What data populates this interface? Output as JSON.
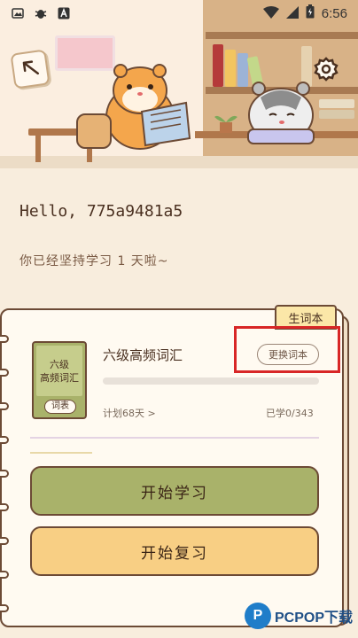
{
  "status_bar": {
    "time": "6:56",
    "left_icons": [
      "photo-icon",
      "bug-icon",
      "a-icon"
    ],
    "right_icons": [
      "wifi-icon",
      "signal-icon",
      "battery-icon"
    ]
  },
  "header": {
    "back_icon": "back-arrow-icon",
    "settings_icon": "gear-icon"
  },
  "greeting": {
    "hello": "Hello, 775a9481a5",
    "persist": "你已经坚持学习 1 天啦~"
  },
  "wordbook": {
    "tab_label": "生词本",
    "cover_title": "六级\n高频词汇",
    "cover_badge": "词表",
    "title": "六级高频词汇",
    "change_label": "更换词本",
    "plan": "计划68天 >",
    "learned": "已学0/343",
    "progress_fraction": 0
  },
  "actions": {
    "start_learn": "开始学习",
    "start_review": "开始复习"
  },
  "watermark": {
    "logo_letter": "P",
    "text": "PCPOP下载"
  },
  "colors": {
    "background": "#f8eddd",
    "learn_button": "#a9b26a",
    "review_button": "#f8cf84",
    "highlight": "#d82626",
    "border": "#6c4a35"
  }
}
